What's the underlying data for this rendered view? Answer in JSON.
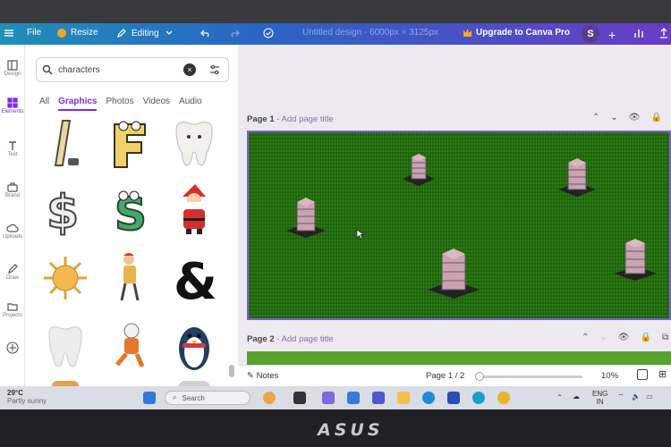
{
  "app": {
    "menu_file": "File",
    "menu_resize": "Resize",
    "menu_editing": "Editing",
    "doc_title": "Untitled design - 6000px × 3125px",
    "upgrade_label": "Upgrade to Canva Pro",
    "avatar_initial": "S"
  },
  "rail": {
    "items": [
      "Design",
      "Elements",
      "Text",
      "Brand",
      "Uploads",
      "Draw",
      "Projects"
    ]
  },
  "panel": {
    "search_value": "characters",
    "tabs": [
      "All",
      "Graphics",
      "Photos",
      "Videos",
      "Audio"
    ],
    "active_tab": "Graphics"
  },
  "pages": {
    "page1_label": "Page 1",
    "page1_title_placeholder": "- Add page title",
    "page2_label": "Page 2",
    "page2_title_placeholder": "- Add page title"
  },
  "status": {
    "notes_label": "Notes",
    "page_counter": "Page 1 / 2",
    "zoom": "10%"
  },
  "taskbar": {
    "weather_temp": "29°C",
    "weather_desc": "Partly sunny",
    "search_placeholder": "Search",
    "lang_line1": "ENG",
    "lang_line2": "IN"
  },
  "colors": {
    "accent": "#7d2ae8",
    "canvas_green": "#58a32e"
  },
  "laptop": {
    "brand": "ASUS"
  }
}
